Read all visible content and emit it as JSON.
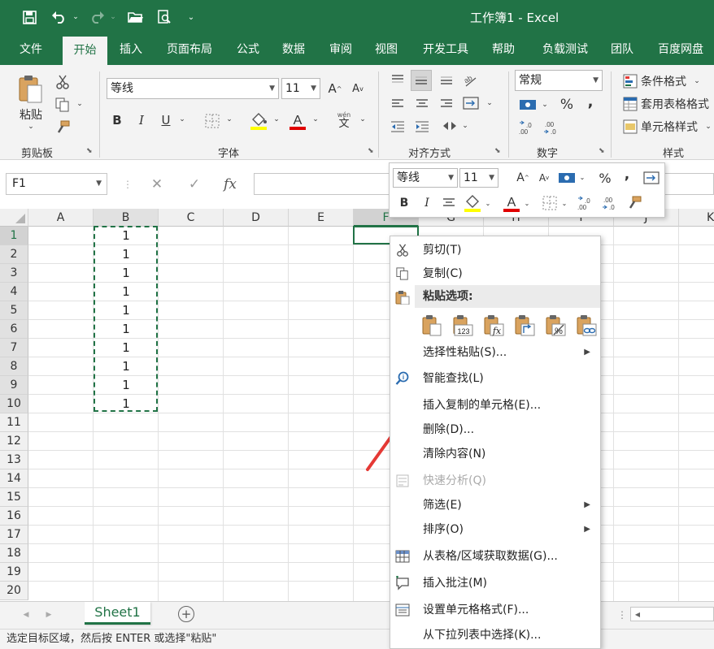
{
  "window": {
    "title": "工作簿1 - Excel"
  },
  "qat": {
    "save_icon": "save-icon",
    "undo_icon": "undo-icon",
    "redo_icon": "redo-icon",
    "open_icon": "open-folder-icon",
    "preview_icon": "print-preview-icon",
    "customize_icon": "customize-qat-icon"
  },
  "tabs": [
    "文件",
    "开始",
    "插入",
    "页面布局",
    "公式",
    "数据",
    "审阅",
    "视图",
    "开发工具",
    "帮助",
    "负载测试",
    "团队",
    "百度网盘"
  ],
  "active_tab": "开始",
  "ribbon": {
    "clipboard": {
      "label": "剪贴板",
      "paste_label": "粘贴"
    },
    "font": {
      "label": "字体",
      "font_name": "等线",
      "font_size": "11",
      "bold": "B",
      "italic": "I",
      "underline": "U",
      "grow": "A",
      "shrink": "A",
      "wen": "wén",
      "wen_char": "文"
    },
    "alignment": {
      "label": "对齐方式"
    },
    "number": {
      "label": "数字",
      "format": "常规",
      "percent": "%",
      "comma": ","
    },
    "styles": {
      "label": "样式",
      "conditional": "条件格式",
      "table_format": "套用表格格式",
      "cell_style": "单元格样式"
    }
  },
  "formula_bar": {
    "name_box": "F1",
    "fx": "fx",
    "cancel": "✕",
    "enter": "✓",
    "value": ""
  },
  "grid": {
    "columns": [
      "A",
      "B",
      "C",
      "D",
      "E",
      "F",
      "G",
      "H",
      "I",
      "J",
      "K"
    ],
    "rows": [
      "1",
      "2",
      "3",
      "4",
      "5",
      "6",
      "7",
      "8",
      "9",
      "10",
      "11",
      "12",
      "13",
      "14",
      "15",
      "16",
      "17",
      "18",
      "19",
      "20"
    ],
    "column_b_values": [
      "1",
      "1",
      "1",
      "1",
      "1",
      "1",
      "1",
      "1",
      "1",
      "1"
    ],
    "selected_cell": "F1"
  },
  "mini_toolbar": {
    "font_name": "等线",
    "font_size": "11",
    "bold": "B",
    "italic": "I",
    "percent": "%",
    "comma": ","
  },
  "context_menu": {
    "cut": "剪切(T)",
    "copy": "复制(C)",
    "paste_options_header": "粘贴选项:",
    "paste_special": "选择性粘贴(S)...",
    "smart_lookup": "智能查找(L)",
    "insert_copied": "插入复制的单元格(E)...",
    "delete": "删除(D)...",
    "clear": "清除内容(N)",
    "quick_analysis": "快速分析(Q)",
    "filter": "筛选(E)",
    "sort": "排序(O)",
    "get_data": "从表格/区域获取数据(G)...",
    "insert_comment": "插入批注(M)",
    "format_cells": "设置单元格格式(F)...",
    "pick_list": "从下拉列表中选择(K)..."
  },
  "sheets": [
    "Sheet1"
  ],
  "status": {
    "text": "选定目标区域，然后按 ENTER 或选择\"粘贴\""
  },
  "colors": {
    "brand": "#217346",
    "arrow": "#e53935",
    "font_red": "#e00000",
    "highlight": "#ffff00"
  }
}
